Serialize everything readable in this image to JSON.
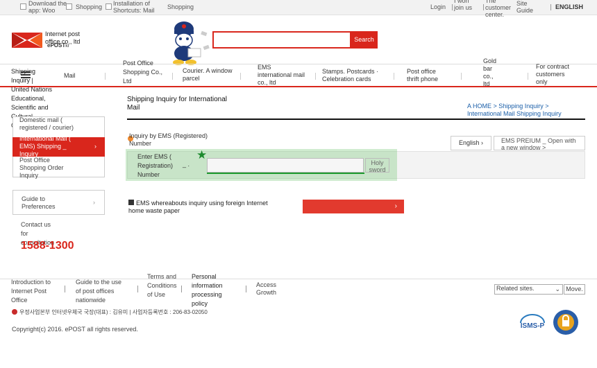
{
  "topbar": {
    "download_app": "Download the app: Woo",
    "shopping1": "Shopping",
    "installation": "Installation of Shortcuts: Mail",
    "shopping2": "Shopping",
    "login": "Login",
    "join": "I won join us",
    "customer_center": "The customer center.",
    "site_guide": "Site Guide",
    "english": "ENGLISH"
  },
  "header": {
    "logo_text": "Internet post office co., ltd",
    "logo_sub": "ePOST",
    "logo_sub_kr": "kr",
    "search_placeholder": "",
    "search_button": "Search"
  },
  "nav": {
    "items": [
      "Mail",
      "Post Office Shopping Co., Ltd",
      "Courier. A window parcel",
      "EMS international mail co., ltd",
      "Stamps. Postcards · Celebration cards",
      "Post office thrift phone",
      "Gold bar co., ltd",
      "For contract customers only"
    ]
  },
  "sidebar": {
    "title": "Shipping Inquiry | United Nations Educational, Scientific and Cultural Organization",
    "items": [
      "Domestic mail ( registered / courier)",
      "International Mail ( EMS) Shipping _ Inquiry",
      "Post Office Shopping Order Inquiry"
    ],
    "preferences": "Guide to Preferences",
    "contact": "Contact us for consultation",
    "phone": "1588-1300"
  },
  "main": {
    "title": "Shipping Inquiry for International Mail",
    "breadcrumb": "A HOME > Shipping Inquiry > International Mail Shipping Inquiry",
    "section_label": "Inquiry by EMS (Registered) Number",
    "lang_button": "English",
    "ems_window_button": "EMS PREIUM _ Open with a new window >",
    "enter_label": "Enter EMS ( Registration) Number",
    "enter_suffix": "_ .",
    "holy_button": "Holy sword",
    "waste_text": "EMS whereabouts inquiry using foreign Internet home waste paper",
    "red_button_arrow": "›"
  },
  "footer": {
    "links": [
      "Introduction to Internet Post Office",
      "Guide to the use of post offices nationwide",
      "Terms and Conditions of Use",
      "Personal information processing policy",
      "Access Growth"
    ],
    "related_sites": "Related sites.",
    "move": "Move.",
    "ministry": "우정사업본부  인터넷우체국 국장(대표) : 김유미  |  사업자등록번호 : 206-83-02050",
    "copyright": "Copyright(c) 2016. ePOST all rights reserved."
  },
  "colors": {
    "brand_red": "#d9261c",
    "highlight_green": "#1d9a2e"
  }
}
